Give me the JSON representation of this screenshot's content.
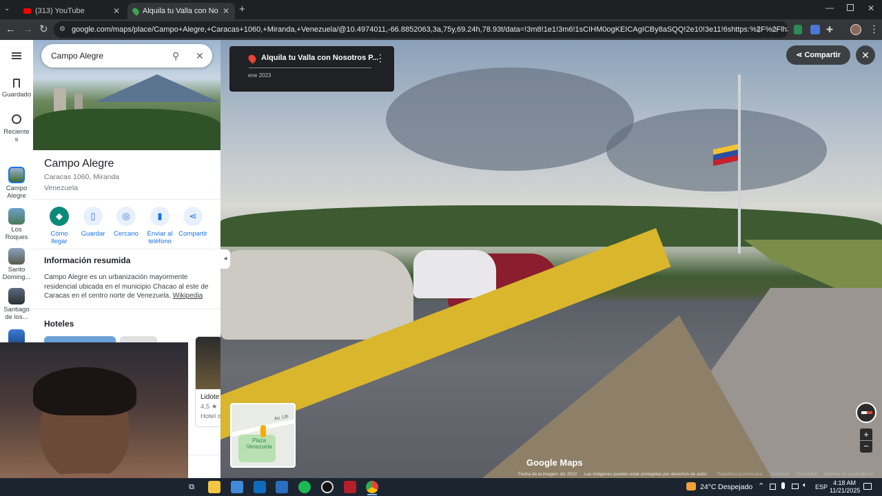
{
  "browser": {
    "tabs": [
      {
        "title": "(313) YouTube"
      },
      {
        "title": "Alquila tu Valla con Nosotros P..."
      }
    ],
    "url": "google.com/maps/place/Campo+Alegre,+Caracas+1060,+Miranda,+Venezuela/@10.4974011,-66.8852063,3a,75y,69.24h,78.93t/data=!3m8!1e1!3m6!1sCIHM0ogKEICAgICBy8aSQQ!2e10!3e11!6shttps:%2F%2Flh3.googleusercontent.com%..."
  },
  "rail": {
    "saved": "Guardado",
    "recents": "Reciente s",
    "places": [
      {
        "label": "Campo Alegre"
      },
      {
        "label": "Los Roques"
      },
      {
        "label": "Santo Doming..."
      },
      {
        "label": "Santiago de los..."
      }
    ]
  },
  "search": {
    "value": "Campo Alegre"
  },
  "place": {
    "name": "Campo Alegre",
    "address_line1": "Caracas 1060, Miranda",
    "address_line2": "Venezuela",
    "actions": [
      "Cómo llegar",
      "Guardar",
      "Cercano",
      "Enviar al teléfono",
      "Compartir"
    ],
    "summary_title": "Información resumida",
    "summary_text": "Campo Alegre es un urbanización mayormente residencial ubicada en el municipio Chacao al este de Caracas en el centro norte de Venezuela.",
    "summary_link": "Wikipedia",
    "hotels_title": "Hoteles",
    "hotel_card": {
      "name": "Lidote",
      "rating": "4,5 ★",
      "type": "Hotel d"
    }
  },
  "streetview": {
    "card_title": "Alquila tu Valla con Nosotros P...",
    "card_date": "ene 2023",
    "share_label": "Compartir",
    "minimap_street": "Av. Lib",
    "minimap_place": "Plaza Venezuela",
    "watermark": "Google Maps",
    "footer": [
      "Fecha de la imagen: dic 2022",
      "Las imágenes pueden estar protegidas por derechos de autor.",
      "República Dominicana",
      "Términos",
      "Privacidad",
      "Informar de un problema"
    ]
  },
  "taskbar": {
    "weather_temp": "24°C",
    "weather_desc": "Despejado",
    "lang": "ESP",
    "time": "4:18 AM",
    "date": "11/21/2025"
  }
}
